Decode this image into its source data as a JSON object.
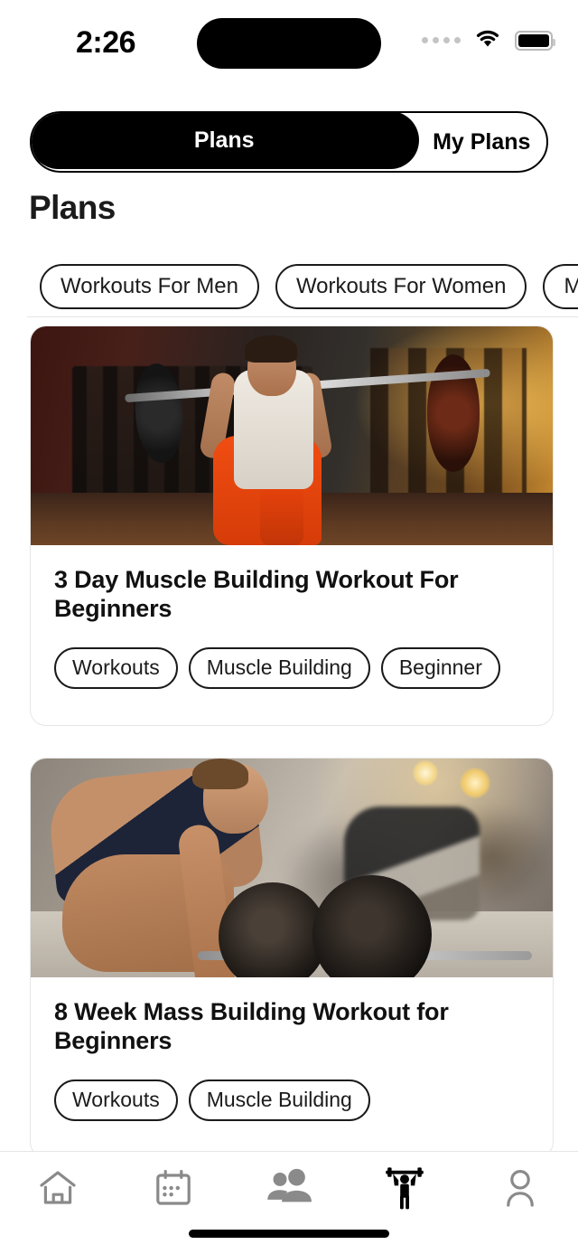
{
  "status_bar": {
    "time": "2:26",
    "signal_icon": "signal-dots-icon",
    "wifi_icon": "wifi-icon",
    "battery_icon": "battery-full-icon"
  },
  "segmented_control": {
    "tabs": [
      {
        "label": "Plans",
        "active": true
      },
      {
        "label": "My Plans",
        "active": false
      }
    ]
  },
  "page_title": "Plans",
  "filter_chips": [
    {
      "label": "Workouts For Men"
    },
    {
      "label": "Workouts For Women"
    },
    {
      "label": "Mus"
    }
  ],
  "plan_cards": [
    {
      "title": "3 Day Muscle Building Workout For Beginners",
      "image_alt": "woman-lunging-with-barbell-in-gym",
      "tags": [
        "Workouts",
        "Muscle Building",
        "Beginner"
      ]
    },
    {
      "title": "8 Week Mass Building Workout for Beginners",
      "image_alt": "woman-deadlifting-barbell-in-gym",
      "tags": [
        "Workouts",
        "Muscle Building"
      ]
    }
  ],
  "bottom_nav": [
    {
      "icon": "home-icon",
      "active": false
    },
    {
      "icon": "calendar-icon",
      "active": false
    },
    {
      "icon": "people-icon",
      "active": false
    },
    {
      "icon": "weightlifter-icon",
      "active": true
    },
    {
      "icon": "profile-icon",
      "active": false
    }
  ],
  "colors": {
    "accent": "#000000",
    "inactive_icon": "#8a8a8a",
    "card_border": "#e6e6e6",
    "text": "#1b1b1b"
  }
}
